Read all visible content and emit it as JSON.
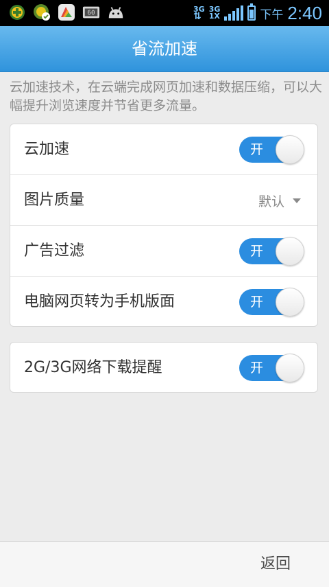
{
  "status_bar": {
    "icons": [
      "plus-game-icon",
      "badge-icon",
      "store-icon",
      "battery-monitor-icon",
      "android-icon"
    ],
    "network_top": "3G",
    "network_top2": "3G",
    "network_bottom": "1X",
    "ampm": "下午",
    "time": "2:40"
  },
  "header": {
    "title": "省流加速"
  },
  "description": "云加速技术，在云端完成网页加速和数据压缩，可以大幅提升浏览速度并节省更多流量。",
  "settings_group_1": [
    {
      "label": "云加速",
      "type": "toggle",
      "toggle_text": "开"
    },
    {
      "label": "图片质量",
      "type": "select",
      "value": "默认"
    },
    {
      "label": "广告过滤",
      "type": "toggle",
      "toggle_text": "开"
    },
    {
      "label": "电脑网页转为手机版面",
      "type": "toggle",
      "toggle_text": "开"
    }
  ],
  "settings_group_2": [
    {
      "label": "2G/3G网络下载提醒",
      "type": "toggle",
      "toggle_text": "开"
    }
  ],
  "footer": {
    "back_label": "返回"
  },
  "colors": {
    "accent": "#2b8de0",
    "header_top": "#68b9ee",
    "header_bottom": "#2f93dc"
  }
}
